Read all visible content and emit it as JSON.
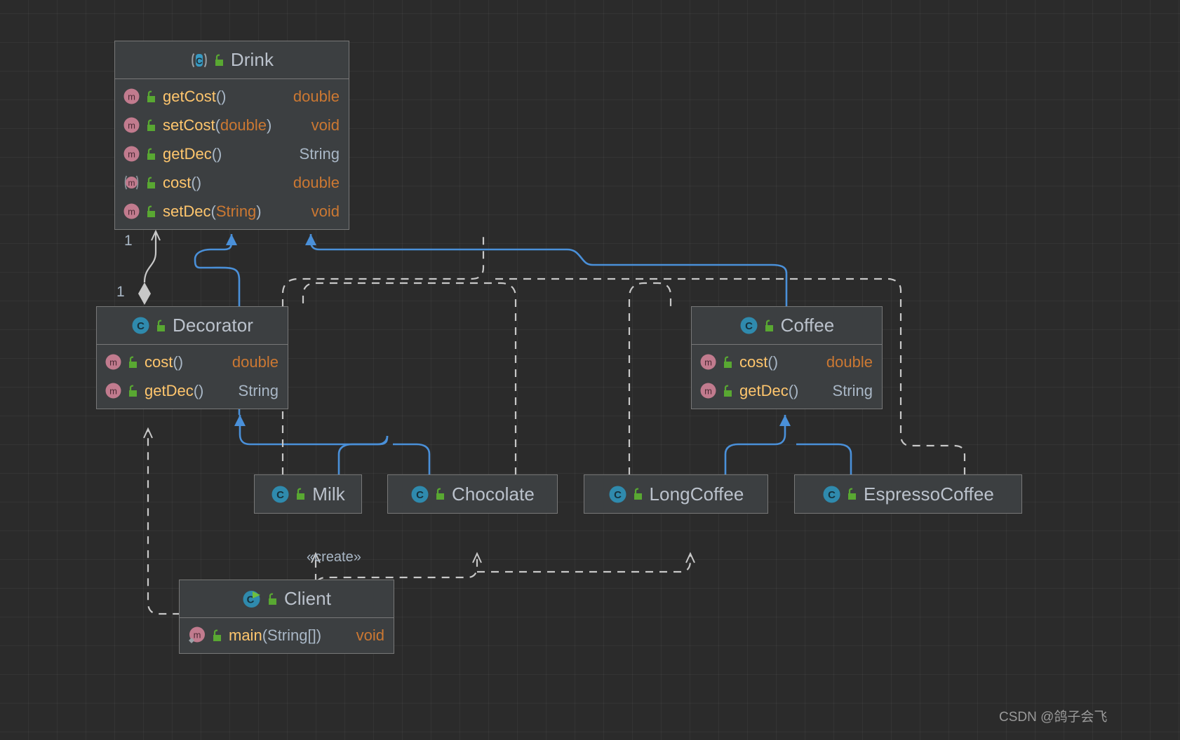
{
  "diagram": {
    "type": "uml-class-diagram",
    "theme": "dark",
    "background_color": "#2b2b2b",
    "node_fill": "#3c3f41",
    "node_border": "#787878",
    "inheritance_color": "#4a90d9",
    "dependency_color": "#c8c8c8",
    "watermark": "CSDN @鸽子会飞"
  },
  "nodes": {
    "drink": {
      "name": "Drink",
      "icon": "abstract-class-icon",
      "visibility_icon": "public-unlock-icon",
      "members": [
        {
          "name": "getCost",
          "params": "",
          "type": "double",
          "icon": "method-icon",
          "visibility_icon": "public-unlock-icon",
          "abstract": false
        },
        {
          "name": "setCost",
          "params": "double",
          "type": "void",
          "icon": "method-icon",
          "visibility_icon": "public-unlock-icon",
          "abstract": false
        },
        {
          "name": "getDec",
          "params": "",
          "type": "String",
          "icon": "method-icon",
          "visibility_icon": "public-unlock-icon",
          "abstract": false
        },
        {
          "name": "cost",
          "params": "",
          "type": "double",
          "icon": "abstract-method-icon",
          "visibility_icon": "public-unlock-icon",
          "abstract": true
        },
        {
          "name": "setDec",
          "params": "String",
          "type": "void",
          "icon": "method-icon",
          "visibility_icon": "public-unlock-icon",
          "abstract": false
        }
      ]
    },
    "decorator": {
      "name": "Decorator",
      "icon": "class-icon",
      "visibility_icon": "public-unlock-icon",
      "members": [
        {
          "name": "cost",
          "params": "",
          "type": "double",
          "icon": "method-icon",
          "visibility_icon": "public-unlock-icon",
          "abstract": false
        },
        {
          "name": "getDec",
          "params": "",
          "type": "String",
          "icon": "method-icon",
          "visibility_icon": "public-unlock-icon",
          "abstract": false
        }
      ]
    },
    "coffee": {
      "name": "Coffee",
      "icon": "class-icon",
      "visibility_icon": "public-unlock-icon",
      "members": [
        {
          "name": "cost",
          "params": "",
          "type": "double",
          "icon": "method-icon",
          "visibility_icon": "public-unlock-icon",
          "abstract": false
        },
        {
          "name": "getDec",
          "params": "",
          "type": "String",
          "icon": "method-icon",
          "visibility_icon": "public-unlock-icon",
          "abstract": false
        }
      ]
    },
    "milk": {
      "name": "Milk",
      "icon": "class-icon",
      "visibility_icon": "public-unlock-icon",
      "members": []
    },
    "chocolate": {
      "name": "Chocolate",
      "icon": "class-icon",
      "visibility_icon": "public-unlock-icon",
      "members": []
    },
    "long_coffee": {
      "name": "LongCoffee",
      "icon": "class-icon",
      "visibility_icon": "public-unlock-icon",
      "members": []
    },
    "espresso_coffee": {
      "name": "EspressoCoffee",
      "icon": "class-icon",
      "visibility_icon": "public-unlock-icon",
      "members": []
    },
    "client": {
      "name": "Client",
      "icon": "runnable-class-icon",
      "visibility_icon": "public-unlock-icon",
      "members": [
        {
          "name": "main",
          "params": "String[]",
          "type": "void",
          "icon": "static-method-icon",
          "visibility_icon": "public-unlock-icon",
          "abstract": false
        }
      ]
    }
  },
  "edges": {
    "aggregation": {
      "from": "decorator",
      "to": "drink",
      "kind": "aggregation",
      "source_multiplicity": "1",
      "target_multiplicity": "1"
    },
    "stereotype_create": "«create»",
    "generalizations": [
      {
        "from": "decorator",
        "to": "drink"
      },
      {
        "from": "coffee",
        "to": "drink"
      },
      {
        "from": "milk",
        "to": "decorator"
      },
      {
        "from": "chocolate",
        "to": "decorator"
      },
      {
        "from": "long_coffee",
        "to": "coffee"
      },
      {
        "from": "espresso_coffee",
        "to": "coffee"
      }
    ],
    "dependencies": [
      {
        "from": "client",
        "to": "decorator"
      },
      {
        "from": "client",
        "to": "milk"
      },
      {
        "from": "client",
        "to": "chocolate"
      },
      {
        "from": "client",
        "to": "long_coffee"
      },
      {
        "from": "milk",
        "to": "drink"
      },
      {
        "from": "chocolate",
        "to": "drink"
      },
      {
        "from": "long_coffee",
        "to": "drink"
      },
      {
        "from": "espresso_coffee",
        "to": "drink"
      }
    ]
  }
}
